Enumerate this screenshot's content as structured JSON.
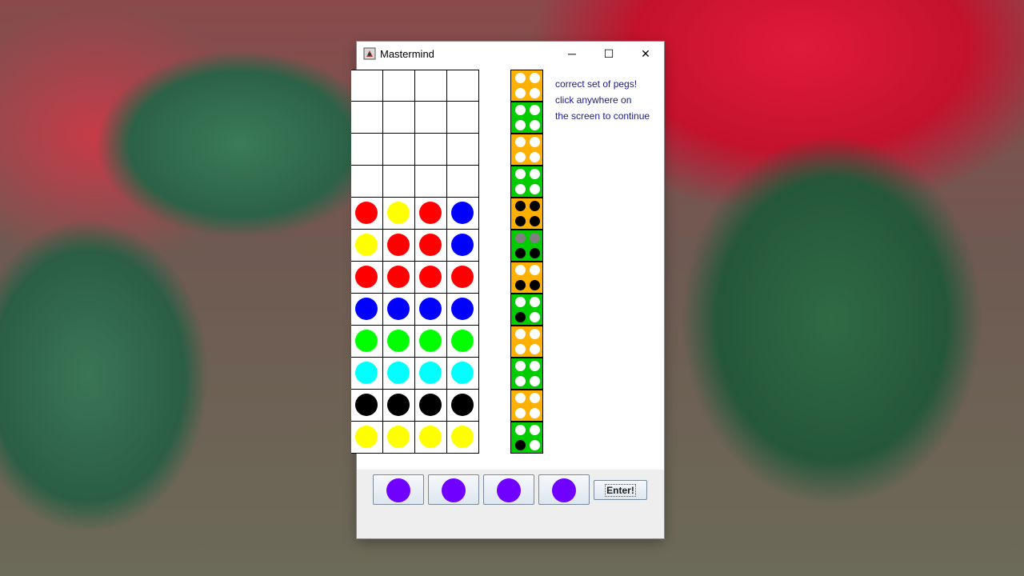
{
  "window": {
    "title": "Mastermind",
    "minimize_glyph": "─",
    "maximize_glyph": "☐",
    "close_glyph": "✕"
  },
  "colors": {
    "red": "#ff0000",
    "yellow": "#ffff00",
    "blue": "#0000ff",
    "green": "#00ff00",
    "cyan": "#00ffff",
    "black": "#000000",
    "purple": "#7000ff",
    "gray": "#808080",
    "white": "#ffffff",
    "fb_orange": "#ffb000",
    "fb_green": "#00cc00"
  },
  "board": {
    "rows": [
      [
        "",
        "",
        "",
        ""
      ],
      [
        "",
        "",
        "",
        ""
      ],
      [
        "",
        "",
        "",
        ""
      ],
      [
        "",
        "",
        "",
        ""
      ],
      [
        "red",
        "yellow",
        "red",
        "blue"
      ],
      [
        "yellow",
        "red",
        "red",
        "blue"
      ],
      [
        "red",
        "red",
        "red",
        "red"
      ],
      [
        "blue",
        "blue",
        "blue",
        "blue"
      ],
      [
        "green",
        "green",
        "green",
        "green"
      ],
      [
        "cyan",
        "cyan",
        "cyan",
        "cyan"
      ],
      [
        "black",
        "black",
        "black",
        "black"
      ],
      [
        "yellow",
        "yellow",
        "yellow",
        "yellow"
      ]
    ]
  },
  "feedback": {
    "rows": [
      {
        "bg": "fb_orange",
        "pegs": [
          "white",
          "white",
          "white",
          "white"
        ]
      },
      {
        "bg": "fb_green",
        "pegs": [
          "white",
          "white",
          "white",
          "white"
        ]
      },
      {
        "bg": "fb_orange",
        "pegs": [
          "white",
          "white",
          "white",
          "white"
        ]
      },
      {
        "bg": "fb_green",
        "pegs": [
          "white",
          "white",
          "white",
          "white"
        ]
      },
      {
        "bg": "fb_orange",
        "pegs": [
          "black",
          "black",
          "black",
          "black"
        ]
      },
      {
        "bg": "fb_green",
        "pegs": [
          "gray",
          "gray",
          "black",
          "black"
        ]
      },
      {
        "bg": "fb_orange",
        "pegs": [
          "white",
          "white",
          "black",
          "black"
        ]
      },
      {
        "bg": "fb_green",
        "pegs": [
          "white",
          "white",
          "black",
          "white"
        ]
      },
      {
        "bg": "fb_orange",
        "pegs": [
          "white",
          "white",
          "white",
          "white"
        ]
      },
      {
        "bg": "fb_green",
        "pegs": [
          "white",
          "white",
          "white",
          "white"
        ]
      },
      {
        "bg": "fb_orange",
        "pegs": [
          "white",
          "white",
          "white",
          "white"
        ]
      },
      {
        "bg": "fb_green",
        "pegs": [
          "white",
          "white",
          "black",
          "white"
        ]
      }
    ]
  },
  "message": {
    "line1": "correct set of pegs!",
    "line2": "click anywhere on",
    "line3": "the screen to continue"
  },
  "controls": {
    "choices": [
      "purple",
      "purple",
      "purple",
      "purple"
    ],
    "enter_label": "Enter!"
  }
}
